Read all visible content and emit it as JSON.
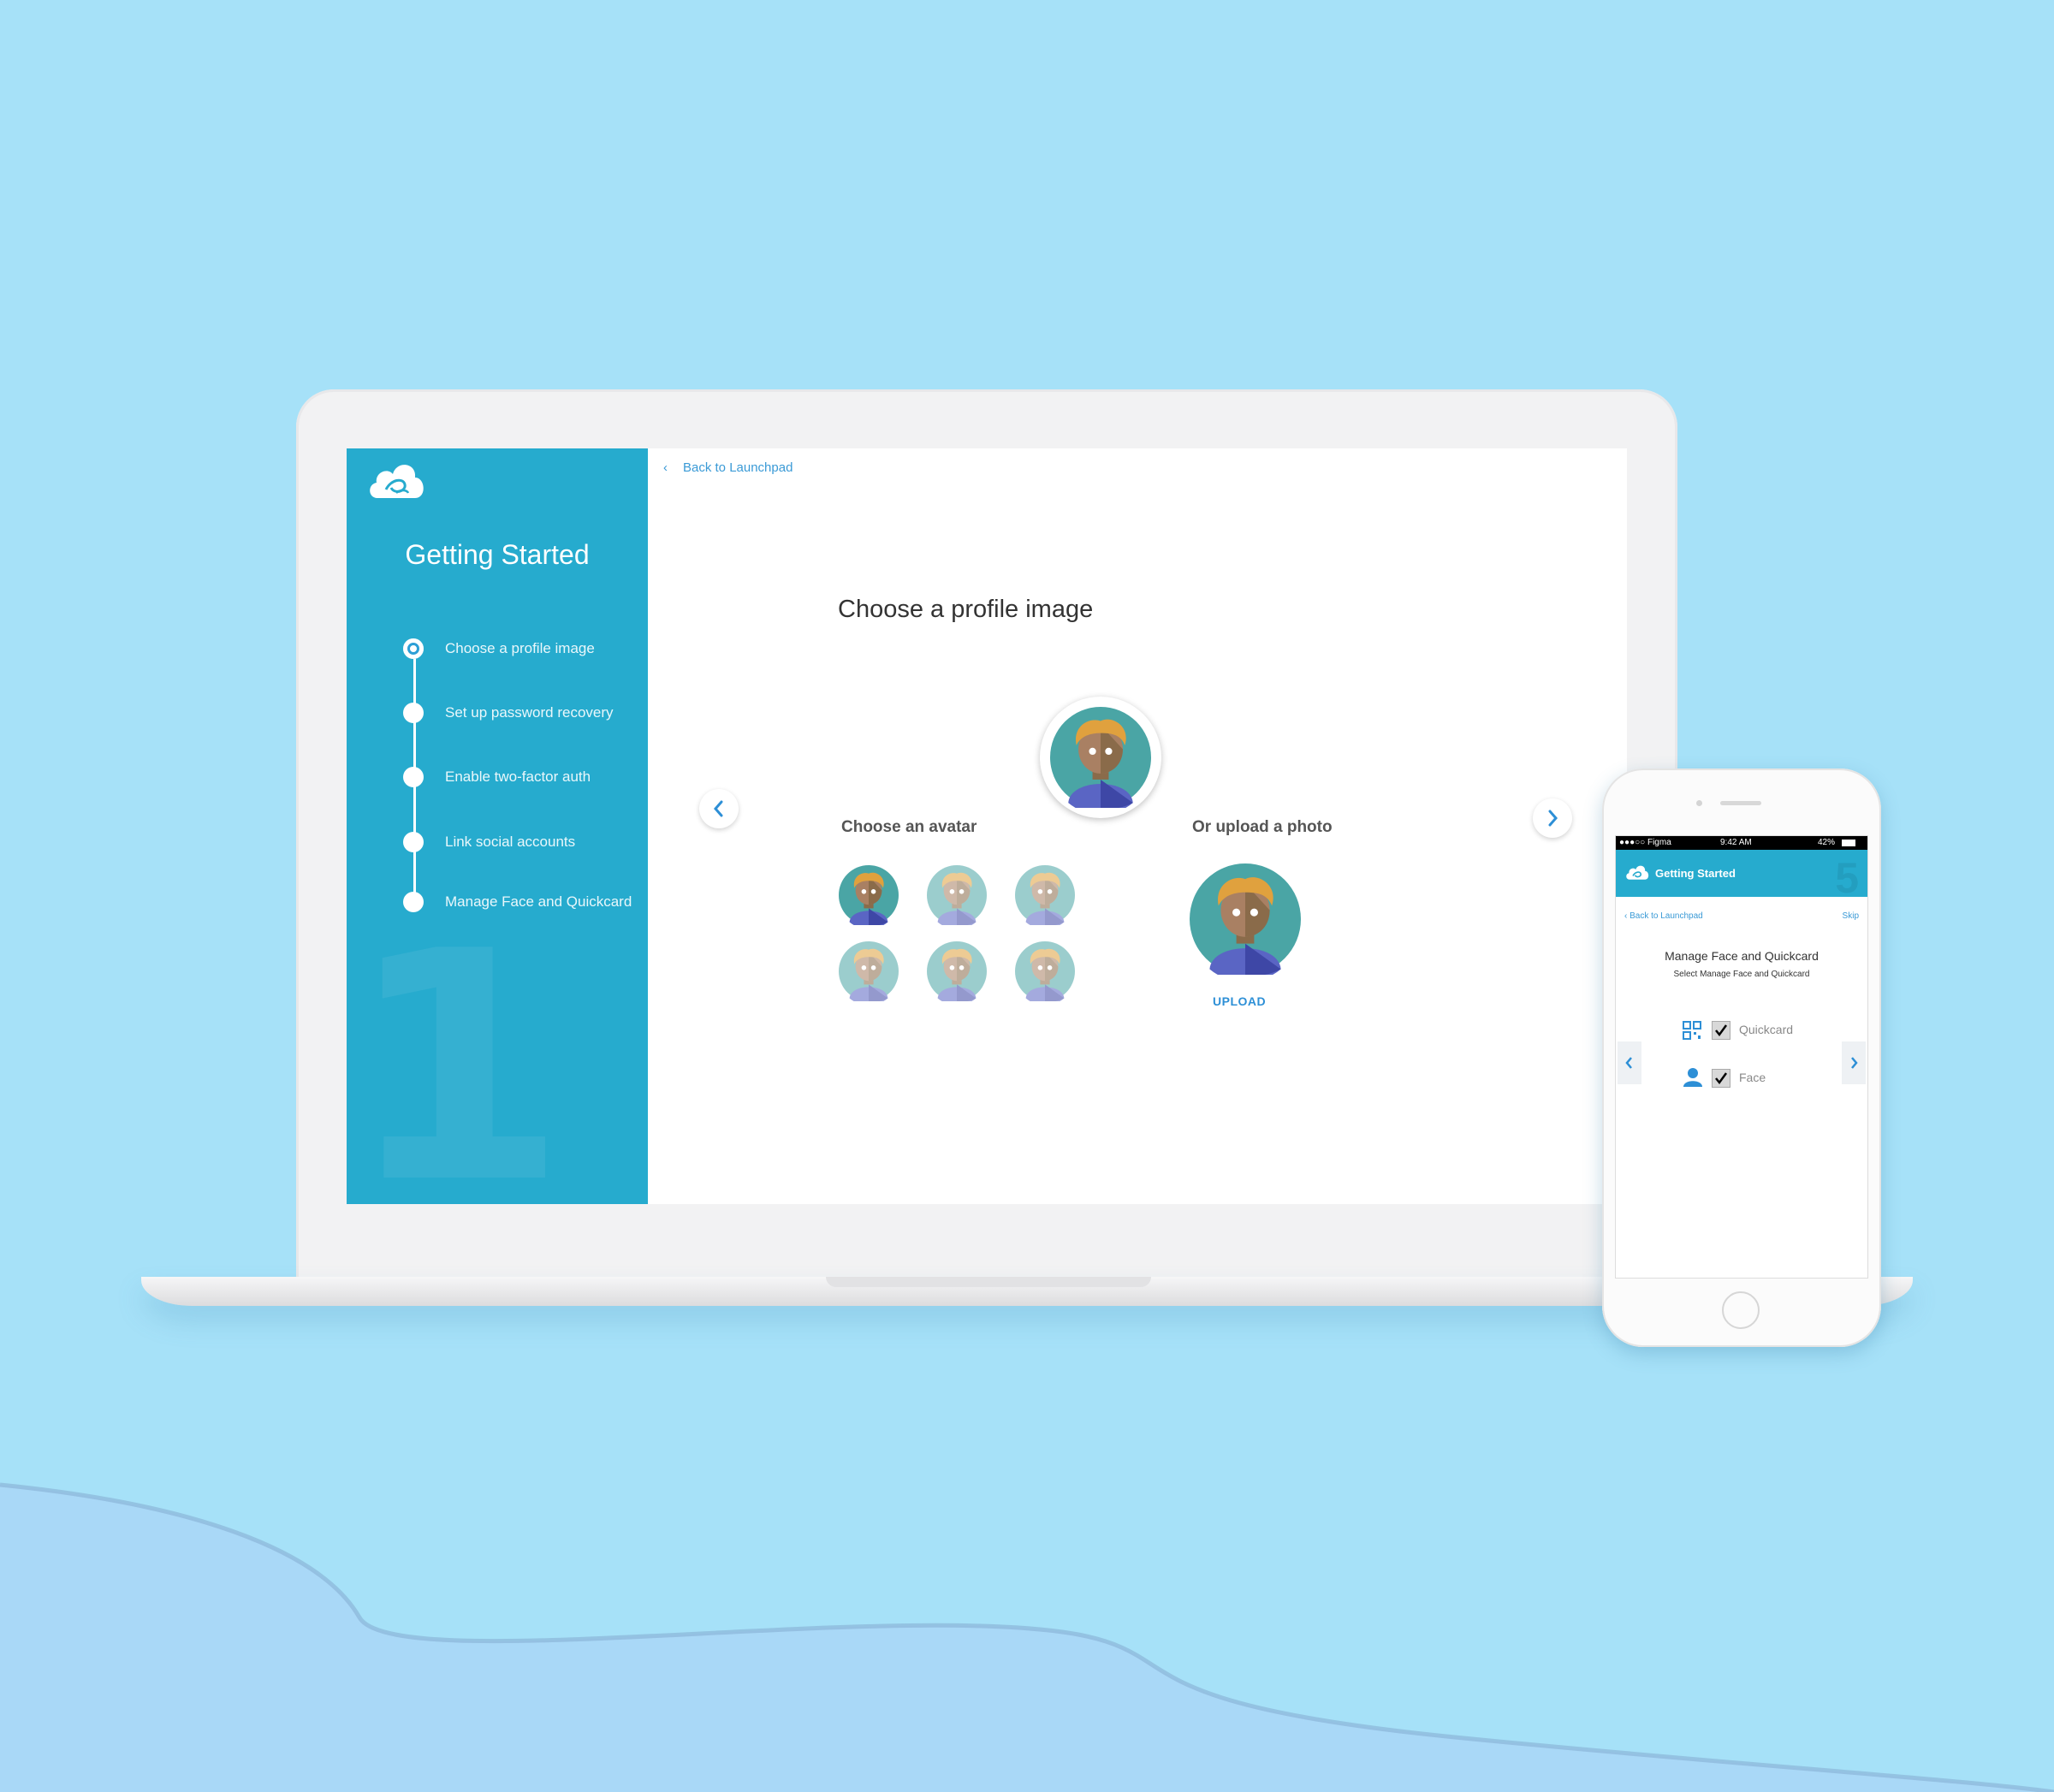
{
  "sidebar": {
    "title": "Getting Started",
    "step_number": "1",
    "steps": [
      {
        "label": "Choose a profile image",
        "active": true
      },
      {
        "label": "Set up password recovery",
        "active": false
      },
      {
        "label": "Enable two-factor auth",
        "active": false
      },
      {
        "label": "Link social accounts",
        "active": false
      },
      {
        "label": "Manage Face and Quickcard",
        "active": false
      }
    ]
  },
  "main": {
    "back_link": "Back to Launchpad",
    "title": "Choose a profile image",
    "avatar_section_label": "Choose an avatar",
    "upload_section_label": "Or upload a photo",
    "upload_button": "UPLOAD",
    "avatar_count": 6
  },
  "phone": {
    "status_left": "●●●○○ Figma",
    "status_time": "9:42 AM",
    "status_right": "42%",
    "header_title": "Getting Started",
    "step_number": "5",
    "back_link": "Back to Launchpad",
    "skip_link": "Skip",
    "heading": "Manage Face and  Quickcard",
    "subheading": "Select Manage Face and Quickcard",
    "options": [
      {
        "label": "Quickcard",
        "checked": true,
        "icon": "qr-code-icon"
      },
      {
        "label": "Face",
        "checked": true,
        "icon": "person-icon"
      }
    ]
  },
  "colors": {
    "background": "#a6e1f8",
    "sidebar": "#26abce",
    "accent": "#2d8fd6"
  }
}
